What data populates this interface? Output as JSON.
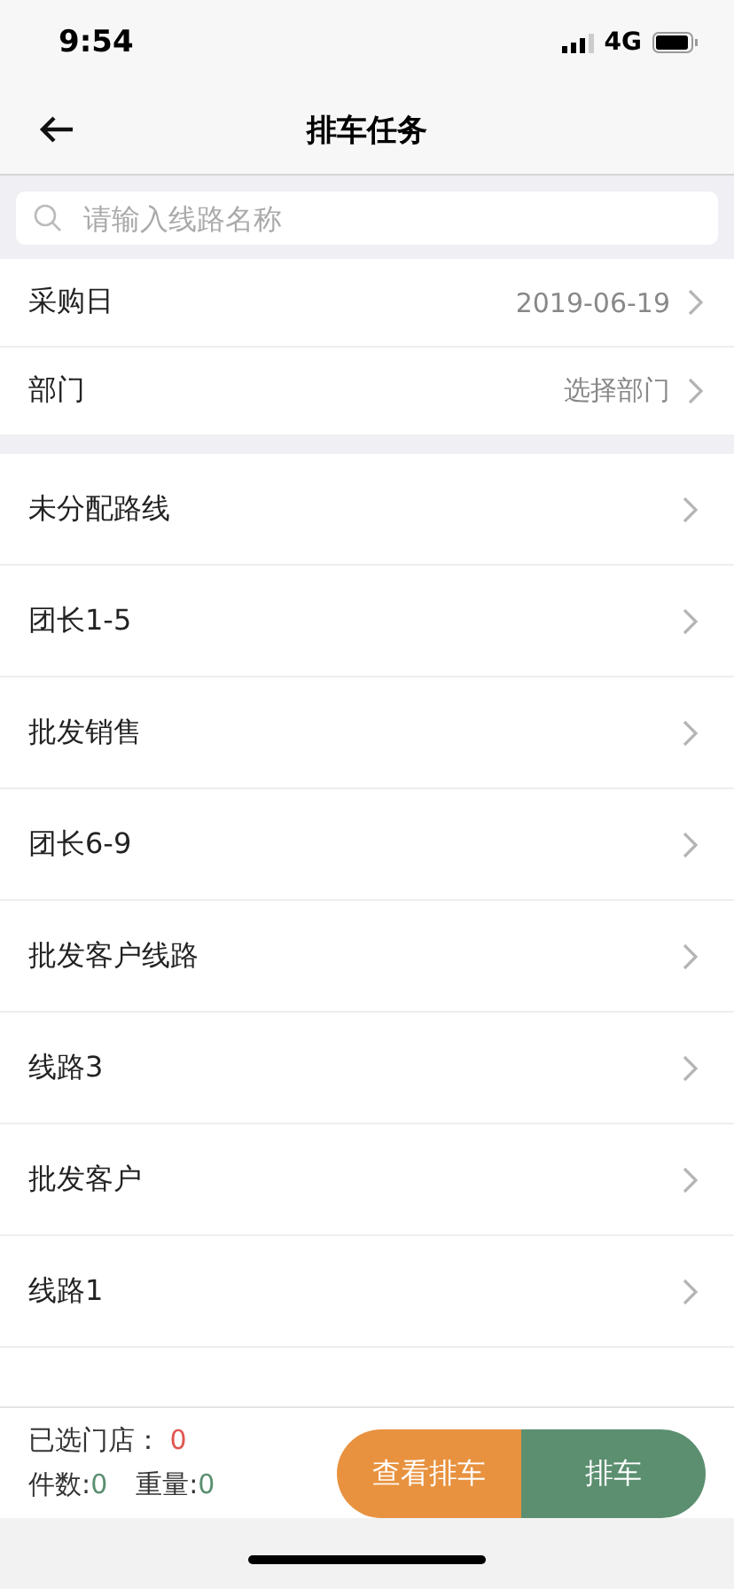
{
  "status_bar": {
    "time": "9:54",
    "network": "4G"
  },
  "nav": {
    "title": "排车任务"
  },
  "search": {
    "placeholder": "请输入线路名称"
  },
  "filters": [
    {
      "label": "采购日",
      "value": "2019-06-19"
    },
    {
      "label": "部门",
      "value": "选择部门"
    }
  ],
  "routes": [
    "未分配路线",
    "团长1-5",
    "批发销售",
    "团长6-9",
    "批发客户线路",
    "线路3",
    "批发客户",
    "线路1"
  ],
  "footer": {
    "stores_label": "已选门店：",
    "stores_count": "0",
    "pieces_label": "件数:",
    "pieces": "0",
    "weight_label": "重量:",
    "weight": "0",
    "buttons": [
      {
        "label": "查看排车",
        "color": "#e8923f"
      },
      {
        "label": "排车",
        "color": "#5b8f70"
      }
    ]
  }
}
